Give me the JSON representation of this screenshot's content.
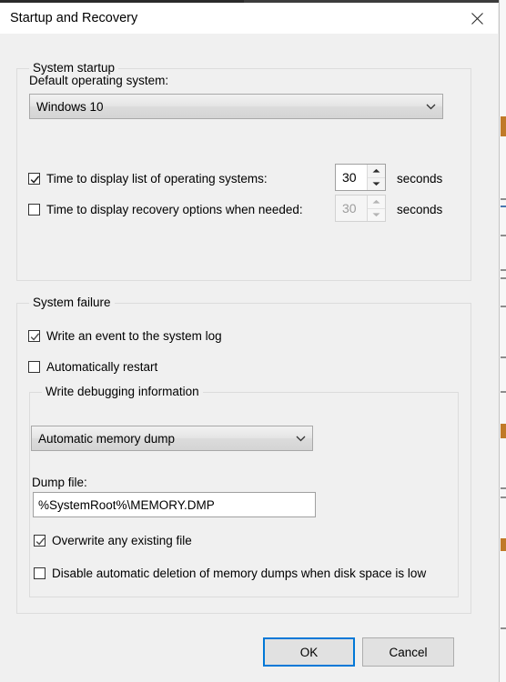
{
  "window": {
    "title": "Startup and Recovery",
    "close_icon": "close-icon"
  },
  "system_startup": {
    "legend": "System startup",
    "default_os_label": "Default operating system:",
    "default_os_value": "Windows 10",
    "default_os_arrow_icon": "chevron-down-icon",
    "os_list_timeout": {
      "label": "Time to display list of operating systems:",
      "checked": "checked",
      "value": "30",
      "units": "seconds",
      "up_icon": "spinner-up-icon",
      "down_icon": "spinner-down-icon"
    },
    "recovery_timeout": {
      "label": "Time to display recovery options when needed:",
      "checked": "unchecked",
      "value": "30",
      "units": "seconds",
      "up_icon": "spinner-up-icon",
      "down_icon": "spinner-down-icon"
    }
  },
  "system_failure": {
    "legend": "System failure",
    "write_event_label": "Write an event to the system log",
    "auto_restart_label": "Automatically restart",
    "debug_group": {
      "legend": "Write debugging information",
      "dump_type_value": "Automatic memory dump",
      "dump_type_arrow_icon": "chevron-down-icon",
      "dump_file_label": "Dump file:",
      "dump_file_value": "%SystemRoot%\\MEMORY.DMP",
      "overwrite_label": "Overwrite any existing file",
      "disable_deletion_label": "Disable automatic deletion of memory dumps when disk space is low"
    }
  },
  "footer": {
    "ok_label": "OK",
    "cancel_label": "Cancel"
  },
  "colors": {
    "accent": "#0078d7",
    "dialog_background": "#f0f0f0",
    "titlebar_background": "#ffffff",
    "group_border": "#dcdcdc"
  }
}
